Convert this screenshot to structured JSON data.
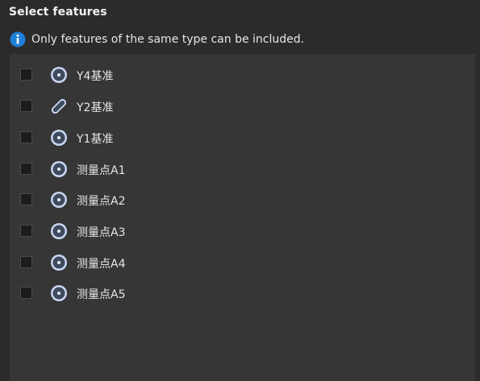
{
  "panel": {
    "title": "Select features",
    "info_text": "Only features of the same type can be included."
  },
  "colors": {
    "accent_info": "#1e7fd6",
    "icon_fill": "#c9d7f2",
    "icon_stroke": "#e8eefc"
  },
  "features": [
    {
      "label": "Y4基准",
      "icon": "point-icon",
      "checked": false
    },
    {
      "label": "Y2基准",
      "icon": "line-icon",
      "checked": false
    },
    {
      "label": "Y1基准",
      "icon": "point-icon",
      "checked": false
    },
    {
      "label": "测量点A1",
      "icon": "point-icon",
      "checked": false
    },
    {
      "label": "测量点A2",
      "icon": "point-icon",
      "checked": false
    },
    {
      "label": "测量点A3",
      "icon": "point-icon",
      "checked": false
    },
    {
      "label": "测量点A4",
      "icon": "point-icon",
      "checked": false
    },
    {
      "label": "测量点A5",
      "icon": "point-icon",
      "checked": false
    }
  ]
}
